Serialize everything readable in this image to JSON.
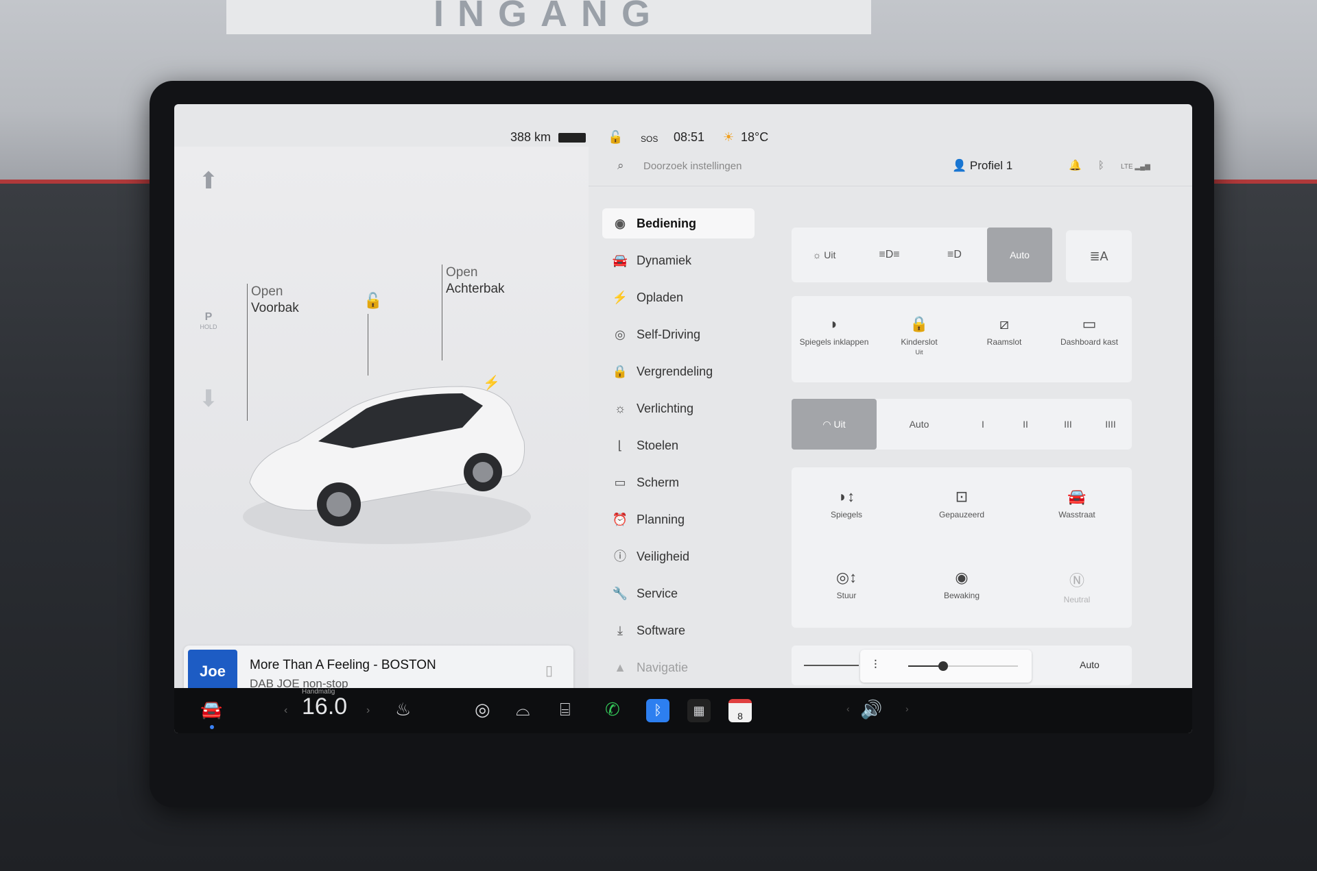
{
  "environment": {
    "sign_text": "INGANG"
  },
  "status": {
    "range": "388 km",
    "sos": "SOS",
    "time": "08:51",
    "temperature": "18°C"
  },
  "search": {
    "placeholder": "Doorzoek instellingen"
  },
  "profile": {
    "label": "Profiel 1"
  },
  "car": {
    "gear_p": "P",
    "gear_hold": "HOLD",
    "frunk_label_line1": "Open",
    "frunk_label_line2": "Voorbak",
    "trunk_label_line1": "Open",
    "trunk_label_line2": "Achterbak"
  },
  "media": {
    "station_logo": "Joe",
    "title": "More Than A Feeling - BOSTON",
    "subtitle": "DAB JOE non-stop"
  },
  "menu": {
    "items": [
      {
        "label": "Bediening",
        "icon": "toggle-icon"
      },
      {
        "label": "Dynamiek",
        "icon": "car-icon"
      },
      {
        "label": "Opladen",
        "icon": "bolt-icon"
      },
      {
        "label": "Self-Driving",
        "icon": "steering-wheel-icon"
      },
      {
        "label": "Vergrendeling",
        "icon": "lock-icon"
      },
      {
        "label": "Verlichting",
        "icon": "sun-icon"
      },
      {
        "label": "Stoelen",
        "icon": "seat-icon"
      },
      {
        "label": "Scherm",
        "icon": "screen-icon"
      },
      {
        "label": "Planning",
        "icon": "clock-icon"
      },
      {
        "label": "Veiligheid",
        "icon": "info-icon"
      },
      {
        "label": "Service",
        "icon": "wrench-icon"
      },
      {
        "label": "Software",
        "icon": "download-icon"
      },
      {
        "label": "Navigatie",
        "icon": "navigation-icon"
      }
    ]
  },
  "lights": {
    "uit": "Uit",
    "auto": "Auto"
  },
  "tiles_row1": {
    "spiegels_inklappen": "Spiegels inklappen",
    "kinderslot": "Kinderslot",
    "kinderslot_sub": "Uit",
    "raamslot": "Raamslot",
    "dashboard_kast": "Dashboard kast"
  },
  "wipers": {
    "uit": "Uit",
    "auto": "Auto",
    "s1": "I",
    "s2": "II",
    "s3": "III",
    "s4": "IIII"
  },
  "tiles_row2": {
    "spiegels": "Spiegels",
    "gepauzeerd": "Gepauzeerd",
    "wasstraat": "Wasstraat",
    "stuur": "Stuur",
    "bewaking": "Bewaking",
    "neutral": "Neutral"
  },
  "brightness": {
    "auto": "Auto"
  },
  "dock": {
    "mode_label": "Handmatig",
    "temperature": "16.0",
    "calendar_day": "8"
  }
}
